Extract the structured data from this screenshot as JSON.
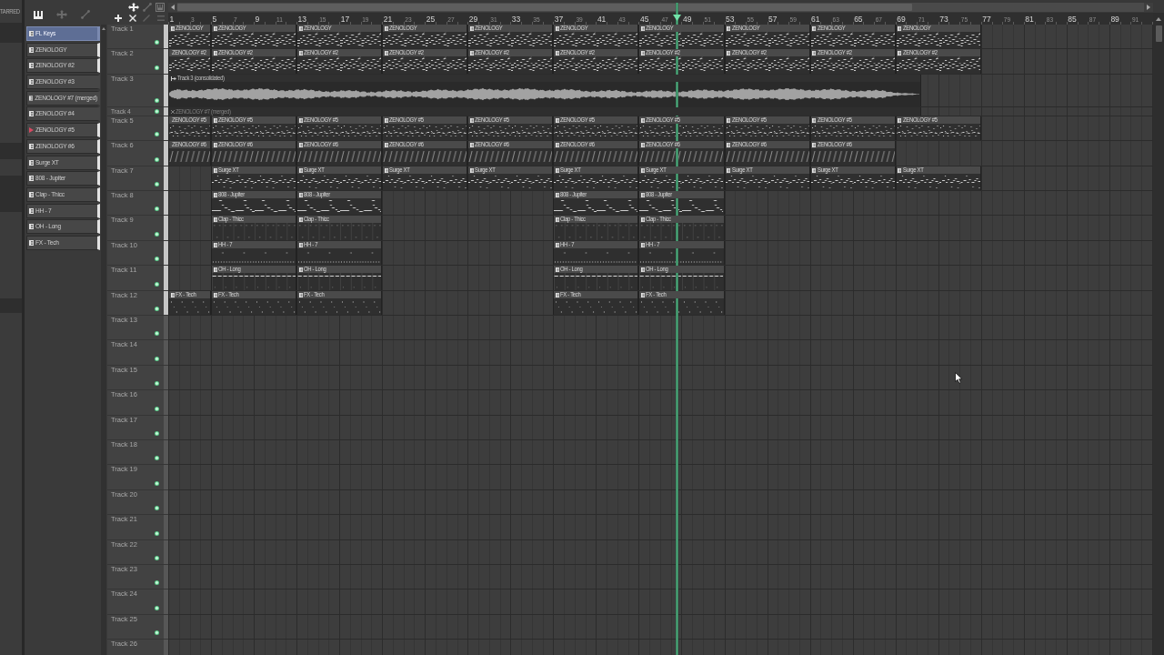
{
  "browser": {
    "heading": "TARRED"
  },
  "picker": {
    "items": [
      {
        "name": "FL Keys",
        "selected": true,
        "marked": false,
        "used": false
      },
      {
        "name": "ZENOLOGY",
        "selected": false,
        "marked": false,
        "used": true
      },
      {
        "name": "ZENOLOGY #2",
        "selected": false,
        "marked": false,
        "used": true
      },
      {
        "name": "ZENOLOGY #3",
        "selected": false,
        "marked": false,
        "used": false
      },
      {
        "name": "ZENOLOGY #7 (merged)",
        "selected": false,
        "marked": false,
        "used": false
      },
      {
        "name": "ZENOLOGY #4",
        "selected": false,
        "marked": false,
        "used": false
      },
      {
        "name": "ZENOLOGY #5",
        "selected": false,
        "marked": true,
        "used": true
      },
      {
        "name": "ZENOLOGY #6",
        "selected": false,
        "marked": false,
        "used": true
      },
      {
        "name": "Surge XT",
        "selected": false,
        "marked": false,
        "used": true
      },
      {
        "name": "808 - Jupiter",
        "selected": false,
        "marked": false,
        "used": true
      },
      {
        "name": "Clap - Thicc",
        "selected": false,
        "marked": false,
        "used": true
      },
      {
        "name": "HH - 7",
        "selected": false,
        "marked": false,
        "used": true
      },
      {
        "name": "OH - Long",
        "selected": false,
        "marked": false,
        "used": true
      },
      {
        "name": "FX - Tech",
        "selected": false,
        "marked": false,
        "used": true
      }
    ]
  },
  "playlist": {
    "bar_numbers": [
      "1",
      "3",
      "5",
      "7",
      "9",
      "11",
      "13",
      "15",
      "17",
      "19",
      "21",
      "23",
      "25",
      "27",
      "29",
      "31",
      "33",
      "35",
      "37",
      "39",
      "41",
      "43",
      "45",
      "47",
      "49",
      "51",
      "53",
      "55",
      "57",
      "59",
      "61",
      "63",
      "65",
      "67",
      "69",
      "71",
      "73",
      "75",
      "77",
      "79",
      "81",
      "83",
      "85",
      "87",
      "89",
      "91"
    ],
    "playhead": {
      "level": 0.517
    },
    "tracks": [
      {
        "name": "Track 1",
        "kind": "normal",
        "on": true,
        "clips": [
          {
            "kind": "pattern",
            "name": "ZENOLOGY",
            "muted": false
          },
          {
            "kind": "pattern",
            "name": "ZENOLOGY",
            "muted": false
          },
          {
            "kind": "pattern",
            "name": "ZENOLOGY",
            "muted": false
          },
          {
            "kind": "pattern",
            "name": "ZENOLOGY",
            "muted": false
          },
          {
            "kind": "pattern",
            "name": "ZENOLOGY",
            "muted": false
          },
          {
            "kind": "pattern",
            "name": "ZENOLOGY",
            "muted": false
          },
          {
            "kind": "pattern",
            "name": "ZENOLOGY",
            "muted": false
          },
          {
            "kind": "pattern",
            "name": "ZENOLOGY",
            "muted": false
          },
          {
            "kind": "pattern",
            "name": "ZENOLOGY",
            "muted": false
          },
          {
            "kind": "pattern",
            "name": "ZENOLOGY",
            "muted": false
          }
        ]
      },
      {
        "name": "Track 2",
        "kind": "normal",
        "on": true,
        "clips": [
          {
            "kind": "pattern",
            "name": "ZENOLOGY #2",
            "muted": false
          },
          {
            "kind": "pattern",
            "name": "ZENOLOGY #2",
            "muted": false
          },
          {
            "kind": "pattern",
            "name": "ZENOLOGY #2",
            "muted": false
          },
          {
            "kind": "pattern",
            "name": "ZENOLOGY #2",
            "muted": false
          },
          {
            "kind": "pattern",
            "name": "ZENOLOGY #2",
            "muted": false
          },
          {
            "kind": "pattern",
            "name": "ZENOLOGY #2",
            "muted": false
          },
          {
            "kind": "pattern",
            "name": "ZENOLOGY #2",
            "muted": false
          },
          {
            "kind": "pattern",
            "name": "ZENOLOGY #2",
            "muted": false
          },
          {
            "kind": "pattern",
            "name": "ZENOLOGY #2",
            "muted": false
          },
          {
            "kind": "pattern",
            "name": "ZENOLOGY #2",
            "muted": false
          }
        ]
      },
      {
        "name": "Track 3",
        "kind": "tall",
        "on": true,
        "clips": [
          {
            "kind": "audio",
            "name": "Track 3 (consolidated)",
            "muted": false
          }
        ]
      },
      {
        "name": "Track 4",
        "kind": "compact",
        "on": true,
        "clips": [
          {
            "kind": "pattern",
            "name": "ZENOLOGY #7 (merged)",
            "muted": true
          }
        ]
      },
      {
        "name": "Track 5",
        "kind": "normal",
        "on": true,
        "clips": [
          {
            "kind": "pattern",
            "name": "ZENOLOGY #5",
            "muted": false
          },
          {
            "kind": "pattern",
            "name": "ZENOLOGY #5",
            "muted": false
          },
          {
            "kind": "pattern",
            "name": "ZENOLOGY #5",
            "muted": false
          },
          {
            "kind": "pattern",
            "name": "ZENOLOGY #5",
            "muted": false
          },
          {
            "kind": "pattern",
            "name": "ZENOLOGY #5",
            "muted": false
          },
          {
            "kind": "pattern",
            "name": "ZENOLOGY #5",
            "muted": false
          },
          {
            "kind": "pattern",
            "name": "ZENOLOGY #5",
            "muted": false
          },
          {
            "kind": "pattern",
            "name": "ZENOLOGY #5",
            "muted": false
          },
          {
            "kind": "pattern",
            "name": "ZENOLOGY #5",
            "muted": false
          },
          {
            "kind": "pattern",
            "name": "ZENOLOGY #5",
            "muted": false
          }
        ]
      },
      {
        "name": "Track 6",
        "kind": "normal",
        "on": true,
        "clips": [
          {
            "kind": "pattern",
            "name": "ZENOLOGY #6",
            "muted": false
          },
          {
            "kind": "pattern",
            "name": "ZENOLOGY #6",
            "muted": false
          },
          {
            "kind": "pattern",
            "name": "ZENOLOGY #6",
            "muted": false
          },
          {
            "kind": "pattern",
            "name": "ZENOLOGY #6",
            "muted": false
          },
          {
            "kind": "pattern",
            "name": "ZENOLOGY #6",
            "muted": false
          },
          {
            "kind": "pattern",
            "name": "ZENOLOGY #6",
            "muted": false
          },
          {
            "kind": "pattern",
            "name": "ZENOLOGY #6",
            "muted": false
          },
          {
            "kind": "pattern",
            "name": "ZENOLOGY #6",
            "muted": false
          },
          {
            "kind": "pattern",
            "name": "ZENOLOGY #6",
            "muted": false
          }
        ]
      },
      {
        "name": "Track 7",
        "kind": "normal",
        "on": true,
        "clips": [
          {
            "kind": "pattern",
            "name": "Surge XT",
            "muted": false
          },
          {
            "kind": "pattern",
            "name": "Surge XT",
            "muted": false
          },
          {
            "kind": "pattern",
            "name": "Surge XT",
            "muted": false
          },
          {
            "kind": "pattern",
            "name": "Surge XT",
            "muted": false
          },
          {
            "kind": "pattern",
            "name": "Surge XT",
            "muted": false
          },
          {
            "kind": "pattern",
            "name": "Surge XT",
            "muted": false
          },
          {
            "kind": "pattern",
            "name": "Surge XT",
            "muted": false
          },
          {
            "kind": "pattern",
            "name": "Surge XT",
            "muted": false
          },
          {
            "kind": "pattern",
            "name": "Surge XT",
            "muted": false
          }
        ]
      },
      {
        "name": "Track 8",
        "kind": "normal",
        "on": true,
        "clips": [
          {
            "kind": "pattern",
            "name": "808 - Jupiter",
            "muted": false
          },
          {
            "kind": "pattern",
            "name": "808 - Jupiter",
            "muted": false
          },
          {
            "kind": "pattern",
            "name": "808 - Jupiter",
            "muted": false
          },
          {
            "kind": "pattern",
            "name": "808 - Jupiter",
            "muted": false
          }
        ]
      },
      {
        "name": "Track 9",
        "kind": "normal",
        "on": true,
        "clips": [
          {
            "kind": "pattern",
            "name": "Clap - Thicc",
            "muted": false
          },
          {
            "kind": "pattern",
            "name": "Clap - Thicc",
            "muted": false
          },
          {
            "kind": "pattern",
            "name": "Clap - Thicc",
            "muted": false
          },
          {
            "kind": "pattern",
            "name": "Clap - Thicc",
            "muted": false
          }
        ]
      },
      {
        "name": "Track 10",
        "kind": "normal",
        "on": true,
        "clips": [
          {
            "kind": "pattern",
            "name": "HH - 7",
            "muted": false
          },
          {
            "kind": "pattern",
            "name": "HH - 7",
            "muted": false
          },
          {
            "kind": "pattern",
            "name": "HH - 7",
            "muted": false
          },
          {
            "kind": "pattern",
            "name": "HH - 7",
            "muted": false
          }
        ]
      },
      {
        "name": "Track 11",
        "kind": "normal",
        "on": true,
        "clips": [
          {
            "kind": "pattern",
            "name": "OH - Long",
            "muted": false
          },
          {
            "kind": "pattern",
            "name": "OH - Long",
            "muted": false
          },
          {
            "kind": "pattern",
            "name": "OH - Long",
            "muted": false
          },
          {
            "kind": "pattern",
            "name": "OH - Long",
            "muted": false
          }
        ]
      },
      {
        "name": "Track 12",
        "kind": "normal",
        "on": true,
        "clips": [
          {
            "kind": "pattern",
            "name": "FX - Tech",
            "muted": false
          },
          {
            "kind": "pattern",
            "name": "FX - Tech",
            "muted": false
          },
          {
            "kind": "pattern",
            "name": "FX - Tech",
            "muted": false
          },
          {
            "kind": "pattern",
            "name": "FX - Tech",
            "muted": false
          },
          {
            "kind": "pattern",
            "name": "FX - Tech",
            "muted": false
          }
        ]
      },
      {
        "name": "Track 13",
        "kind": "normal",
        "on": true
      },
      {
        "name": "Track 14",
        "kind": "normal",
        "on": true
      },
      {
        "name": "Track 15",
        "kind": "normal",
        "on": true
      },
      {
        "name": "Track 16",
        "kind": "normal",
        "on": true
      },
      {
        "name": "Track 17",
        "kind": "normal",
        "on": true
      },
      {
        "name": "Track 18",
        "kind": "normal",
        "on": true
      },
      {
        "name": "Track 19",
        "kind": "normal",
        "on": true
      },
      {
        "name": "Track 20",
        "kind": "normal",
        "on": true
      },
      {
        "name": "Track 21",
        "kind": "normal",
        "on": true
      },
      {
        "name": "Track 22",
        "kind": "normal",
        "on": true
      },
      {
        "name": "Track 23",
        "kind": "normal",
        "on": true
      },
      {
        "name": "Track 24",
        "kind": "normal",
        "on": true
      },
      {
        "name": "Track 25",
        "kind": "normal",
        "on": true
      },
      {
        "name": "Track 26",
        "kind": "normal"
      }
    ]
  }
}
